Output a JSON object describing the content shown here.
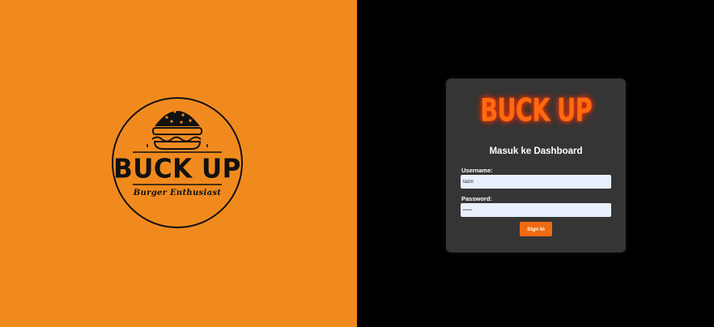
{
  "logo": {
    "brand": "BUCK UP",
    "tagline": "Burger Enthusiast"
  },
  "login": {
    "brand_title": "BUCK UP",
    "subtitle": "Masuk ke Dashboard",
    "username_label": "Username:",
    "username_value": "fazril",
    "password_label": "Password:",
    "password_value": "•••••",
    "signin_label": "Sign In"
  },
  "colors": {
    "left_background": "#f18a1e",
    "right_background": "#000000",
    "card_background": "#353535",
    "accent": "#f06a12",
    "input_background": "#e8f0fe"
  },
  "icons": {
    "logo_emblem": "burger-icon"
  }
}
